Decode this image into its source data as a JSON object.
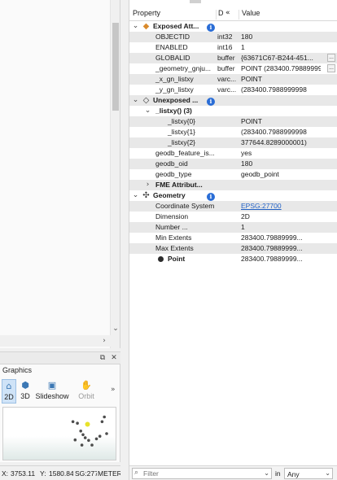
{
  "left": {
    "scroll_down": "⌄",
    "scroll_right": "›"
  },
  "graphics": {
    "title": "Graphics",
    "float_icon": "⧉",
    "close_icon": "✕",
    "tools": [
      {
        "label": "2D",
        "icon": "2d-view-icon"
      },
      {
        "label": "3D",
        "icon": "3d-view-icon"
      },
      {
        "label": "Slideshow",
        "icon": "slideshow-icon"
      },
      {
        "label": "Orbit",
        "icon": "orbit-icon"
      }
    ],
    "more": "»",
    "points": [
      {
        "x": 0.62,
        "y": 0.27,
        "hl": false
      },
      {
        "x": 0.66,
        "y": 0.3,
        "hl": false
      },
      {
        "x": 0.75,
        "y": 0.32,
        "hl": true
      },
      {
        "x": 0.69,
        "y": 0.45,
        "hl": false
      },
      {
        "x": 0.71,
        "y": 0.52,
        "hl": false
      },
      {
        "x": 0.73,
        "y": 0.58,
        "hl": false
      },
      {
        "x": 0.76,
        "y": 0.63,
        "hl": false
      },
      {
        "x": 0.7,
        "y": 0.72,
        "hl": false
      },
      {
        "x": 0.9,
        "y": 0.18,
        "hl": false
      },
      {
        "x": 0.88,
        "y": 0.27,
        "hl": false
      },
      {
        "x": 0.83,
        "y": 0.6,
        "hl": false
      },
      {
        "x": 0.86,
        "y": 0.55,
        "hl": false
      },
      {
        "x": 0.79,
        "y": 0.72,
        "hl": false
      },
      {
        "x": 0.64,
        "y": 0.62,
        "hl": false
      },
      {
        "x": 0.92,
        "y": 0.5,
        "hl": false
      }
    ],
    "highlight_color": "#e8e22a",
    "point_color": "#4d4d4d"
  },
  "status": {
    "x_label": "X:",
    "x_value": "3753.11",
    "y_label": "Y:",
    "y_value": "1580.84",
    "srs": "SG:277",
    "units": "METER"
  },
  "inspector": {
    "headers": {
      "property": "Property",
      "type": "D",
      "type_collapse": "«",
      "value": "Value"
    },
    "exposed": {
      "label": "Exposed Att...",
      "rows": [
        {
          "prop": "OBJECTID",
          "type": "int32",
          "value": "180"
        },
        {
          "prop": "ENABLED",
          "type": "int16",
          "value": "1"
        },
        {
          "prop": "GLOBALID",
          "type": "buffer",
          "value": "{63671C67-B244-451...",
          "more": "..."
        },
        {
          "prop": "_geometry_gnju...",
          "type": "buffer",
          "value": "POINT (283400.79889999...",
          "more": "..."
        },
        {
          "prop": "_x_gn_listxy",
          "type": "varc...",
          "value": "POINT"
        },
        {
          "prop": "_y_gn_listxy",
          "type": "varc...",
          "value": "(283400.7988999998"
        }
      ]
    },
    "unexposed": {
      "label": "Unexposed ...",
      "list_label": "_listxy() (3)",
      "list_rows": [
        {
          "prop": "_listxy{0}",
          "value": "POINT"
        },
        {
          "prop": "_listxy{1}",
          "value": "(283400.7988999998"
        },
        {
          "prop": "_listxy{2}",
          "value": "377644.8289000001)"
        }
      ],
      "rows": [
        {
          "prop": "geodb_feature_is...",
          "value": "yes"
        },
        {
          "prop": "geodb_oid",
          "value": "180"
        },
        {
          "prop": "geodb_type",
          "value": "geodb_point"
        }
      ],
      "fme_label": "FME Attribut..."
    },
    "geometry": {
      "label": "Geometry",
      "rows": [
        {
          "prop": "Coordinate System",
          "value": "EPSG:27700",
          "link": true
        },
        {
          "prop": "Dimension",
          "value": "2D"
        },
        {
          "prop": "Number ...",
          "value": "1"
        },
        {
          "prop": "Min Extents",
          "value": "283400.79889999..."
        },
        {
          "prop": "Max Extents",
          "value": "283400.79889999..."
        }
      ],
      "point_label": "Point",
      "point_value": "283400.79889999..."
    },
    "info_glyph": "i",
    "filter": {
      "placeholder": "Filter",
      "in_label": "in",
      "scope": "Any"
    }
  }
}
